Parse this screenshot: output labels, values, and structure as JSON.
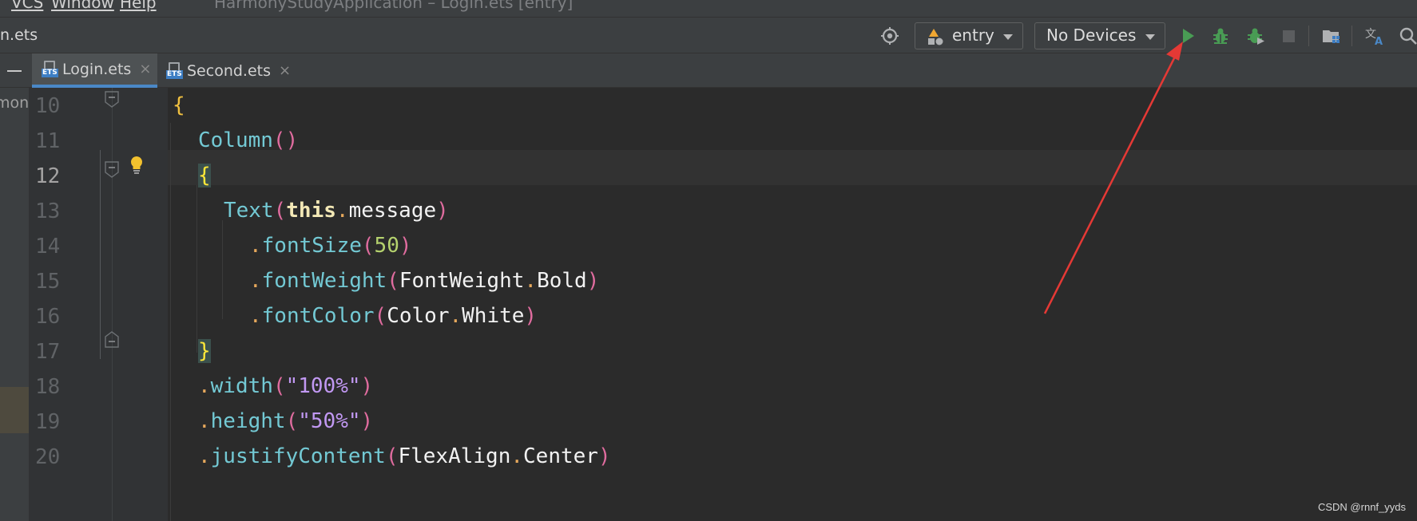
{
  "menu": {
    "items": [
      "VCS",
      "Window",
      "Help"
    ],
    "window_title": "HarmonyStudyApplication – Login.ets [entry]"
  },
  "toolbar": {
    "file_crumb": "n.ets",
    "module_combo": "entry",
    "device_combo": "No Devices",
    "icons": [
      "target-icon",
      "module-icon",
      "run-icon",
      "debug-icon",
      "attach-debugger-icon",
      "stop-icon",
      "project-structure-icon",
      "translate-icon",
      "search-icon"
    ],
    "colors": {
      "run": "#499c54",
      "debug": "#499c54",
      "stop": "#6e6e6e"
    }
  },
  "tabs": [
    {
      "label": "Login.ets",
      "active": true
    },
    {
      "label": "Second.ets",
      "active": false
    }
  ],
  "tab_icon_text": "ETS",
  "close_glyph": "×",
  "left_panel": {
    "project_label": "mony"
  },
  "editor": {
    "current_line": 12,
    "line_numbers": [
      "10",
      "11",
      "12",
      "13",
      "14",
      "15",
      "16",
      "17",
      "18",
      "19",
      "20"
    ],
    "lines": [
      [
        "{"
      ],
      [
        "Column",
        "()"
      ],
      [
        "{"
      ],
      [
        "Text",
        "(",
        "this",
        ".",
        "message",
        ")"
      ],
      [
        ".",
        "fontSize",
        "(",
        "50",
        ")"
      ],
      [
        ".",
        "fontWeight",
        "(",
        "FontWeight",
        ".",
        "Bold",
        ")"
      ],
      [
        ".",
        "fontColor",
        "(",
        "Color",
        ".",
        "White",
        ")"
      ],
      [
        "}"
      ],
      [
        ".",
        "width",
        "(",
        "\"100%\"",
        ")"
      ],
      [
        ".",
        "height",
        "(",
        "\"50%\"",
        ")"
      ],
      [
        ".",
        "justifyContent",
        "(",
        "FlexAlign",
        ".",
        "Center",
        ")"
      ]
    ]
  },
  "annotation": {
    "color": "#e53935"
  },
  "watermark": "CSDN @rnnf_yyds"
}
